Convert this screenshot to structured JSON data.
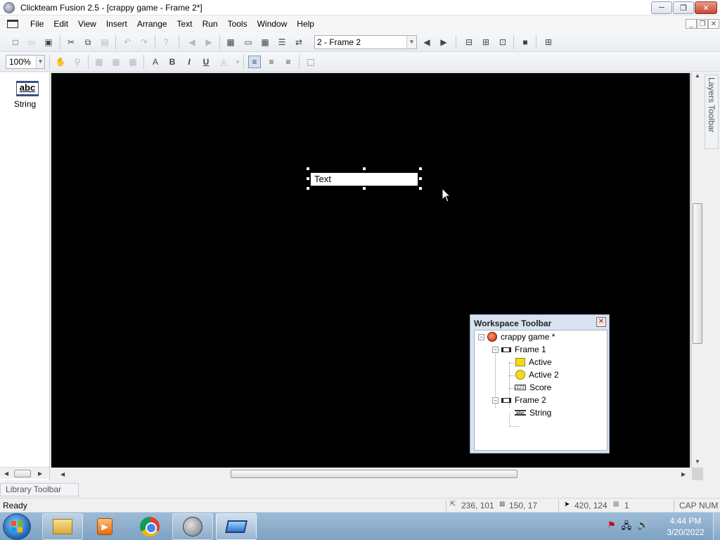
{
  "window": {
    "title": "Clickteam Fusion 2.5 - [crappy game - Frame 2*]",
    "minimize": "─",
    "maximize": "❐",
    "close": "✕"
  },
  "menu": {
    "items": [
      "File",
      "Edit",
      "View",
      "Insert",
      "Arrange",
      "Text",
      "Run",
      "Tools",
      "Window",
      "Help"
    ]
  },
  "mdi": {
    "minimize": "_",
    "restore": "❐",
    "close": "✕"
  },
  "toolbar1": {
    "frame_selector": "2 - Frame 2"
  },
  "toolbar2": {
    "zoom": "100%",
    "bold": "B",
    "italic": "I",
    "underline": "U"
  },
  "library": {
    "item_icon_text": "abc",
    "item_label": "String",
    "tab_label": "Library Toolbar"
  },
  "canvas": {
    "background_color": "#000000",
    "string_object_text": "Text"
  },
  "workspace": {
    "title": "Workspace Toolbar",
    "tree": {
      "game": "crappy game *",
      "frame1": "Frame 1",
      "active": "Active",
      "active2": "Active 2",
      "score": "Score",
      "frame2": "Frame 2",
      "string": "String"
    }
  },
  "layers": {
    "tab_label": "Layers Toolbar"
  },
  "status": {
    "text": "Ready",
    "position": "236, 101",
    "size": "150, 17",
    "mouse": "420, 124",
    "layer": "1",
    "cap": "CAP",
    "num": "NUM"
  },
  "taskbar": {
    "time": "4:44 PM",
    "date": "3/20/2022"
  }
}
